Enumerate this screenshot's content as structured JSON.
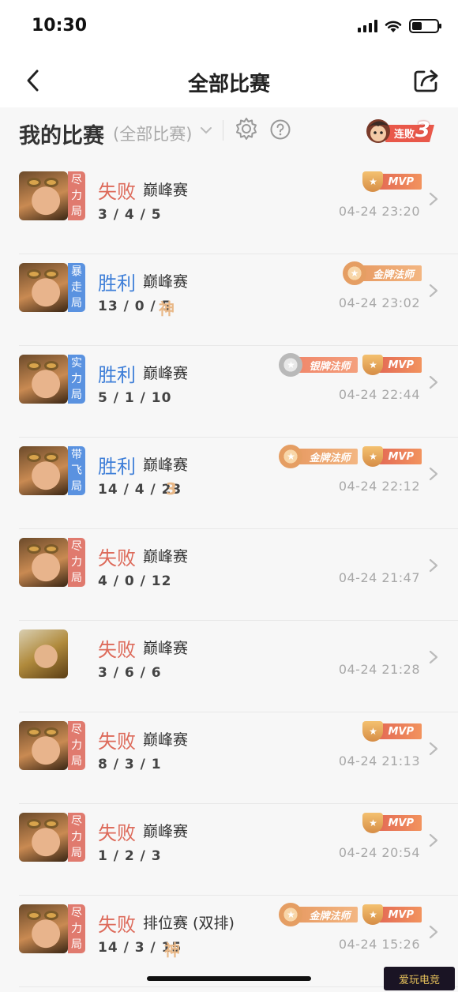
{
  "status_bar": {
    "time": "10:30"
  },
  "nav": {
    "title": "全部比赛"
  },
  "header": {
    "title": "我的比赛",
    "filter": "(全部比赛)",
    "streak_label": "连败",
    "streak_count": "3"
  },
  "matches": [
    {
      "result": "失败",
      "result_type": "lose",
      "mode": "巅峰赛",
      "kda": "3 / 4 / 5",
      "extra": "",
      "time": "04-24 23:20",
      "tag": "尽力局",
      "tag_color": "red",
      "hero": "goggle",
      "badges": [
        "MVP"
      ]
    },
    {
      "result": "胜利",
      "result_type": "win",
      "mode": "巅峰赛",
      "kda": "13 / 0 / 5",
      "extra": "神",
      "time": "04-24 23:02",
      "tag": "暴走局",
      "tag_color": "blue",
      "hero": "goggle",
      "badges": [
        "金牌法师"
      ]
    },
    {
      "result": "胜利",
      "result_type": "win",
      "mode": "巅峰赛",
      "kda": "5 / 1 / 10",
      "extra": "",
      "time": "04-24 22:44",
      "tag": "实力局",
      "tag_color": "blue",
      "hero": "goggle",
      "badges": [
        "银牌法师",
        "MVP"
      ]
    },
    {
      "result": "胜利",
      "result_type": "win",
      "mode": "巅峰赛",
      "kda": "14 / 4 / 23",
      "extra": "3",
      "time": "04-24 22:12",
      "tag": "带飞局",
      "tag_color": "blue",
      "hero": "goggle",
      "badges": [
        "金牌法师",
        "MVP"
      ]
    },
    {
      "result": "失败",
      "result_type": "lose",
      "mode": "巅峰赛",
      "kda": "4 / 0 / 12",
      "extra": "",
      "time": "04-24 21:47",
      "tag": "尽力局",
      "tag_color": "red",
      "hero": "goggle",
      "badges": []
    },
    {
      "result": "失败",
      "result_type": "lose",
      "mode": "巅峰赛",
      "kda": "3 / 6 / 6",
      "extra": "",
      "time": "04-24 21:28",
      "tag": "",
      "tag_color": "",
      "hero": "gold",
      "badges": []
    },
    {
      "result": "失败",
      "result_type": "lose",
      "mode": "巅峰赛",
      "kda": "8 / 3 / 1",
      "extra": "",
      "time": "04-24 21:13",
      "tag": "尽力局",
      "tag_color": "red",
      "hero": "goggle",
      "badges": [
        "MVP"
      ]
    },
    {
      "result": "失败",
      "result_type": "lose",
      "mode": "巅峰赛",
      "kda": "1 / 2 / 3",
      "extra": "",
      "time": "04-24 20:54",
      "tag": "尽力局",
      "tag_color": "red",
      "hero": "goggle",
      "badges": [
        "MVP"
      ]
    },
    {
      "result": "失败",
      "result_type": "lose",
      "mode": "排位赛 (双排)",
      "kda": "14 / 3 / 15",
      "extra": "神",
      "time": "04-24 15:26",
      "tag": "尽力局",
      "tag_color": "red",
      "hero": "goggle",
      "badges": [
        "金牌法师",
        "MVP"
      ]
    }
  ],
  "colors": {
    "lose": "#dd6a5a",
    "win": "#3f7fd8",
    "tag_red": "#e07a6e",
    "tag_blue": "#5a92e0"
  },
  "watermark": "爱玩电竞"
}
